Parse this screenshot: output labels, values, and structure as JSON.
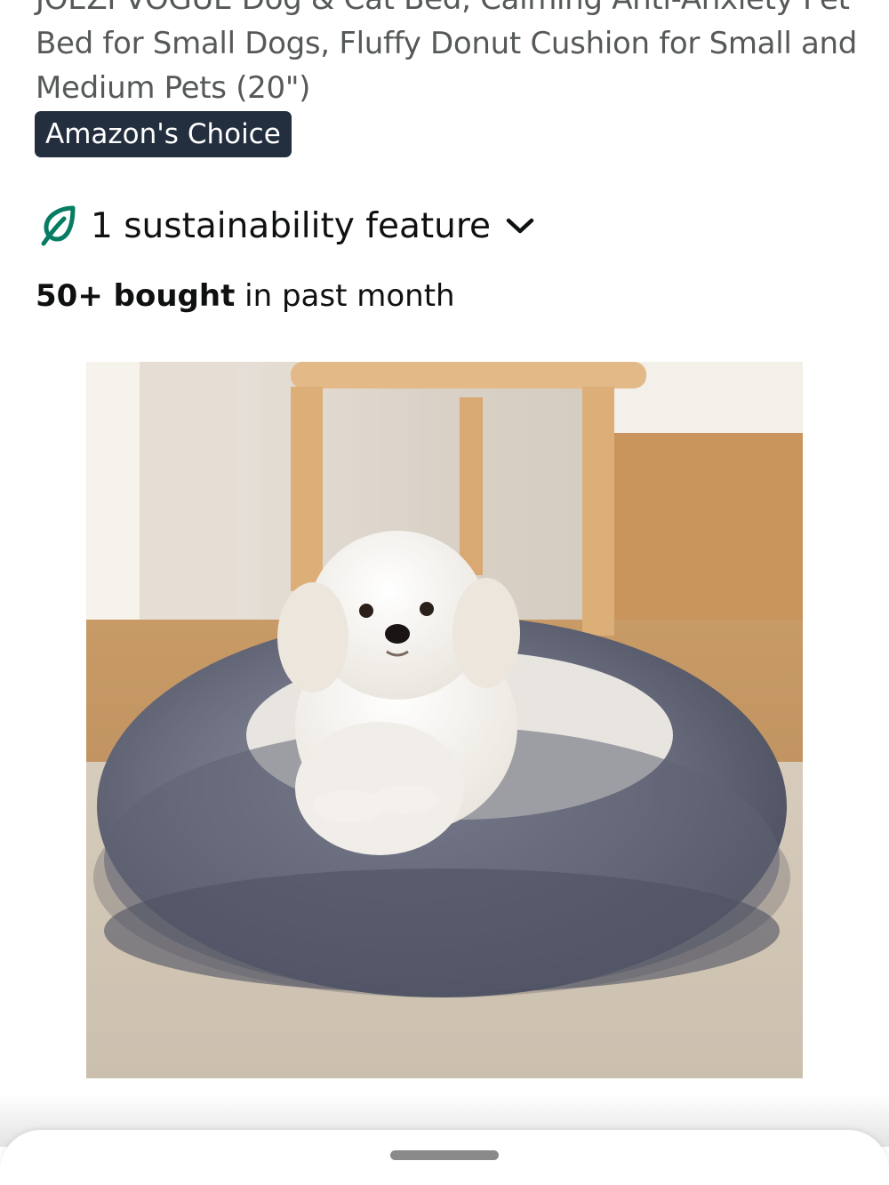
{
  "product": {
    "title_line_1": "JOEZI VOGUE Dog & Cat Bed, Calming Anti-Anxiety Pet",
    "title_line_2": "Bed for Small Dogs, Fluffy Donut Cushion for Small and",
    "title_line_3": "Medium Pets (20\")",
    "badge": "Amazon's Choice",
    "sustainability": {
      "label": "1 sustainability feature",
      "icon": "leaf-icon",
      "expand_icon": "chevron-down-icon"
    },
    "bought": {
      "strong": "50+ bought",
      "rest": " in past month"
    },
    "image_description_icon": "product-image"
  },
  "bottom_sheet": {
    "handle_icon": "drag-handle"
  },
  "colors": {
    "badge_bg": "#232f3e",
    "leaf_green": "#067d62",
    "title_gray": "#565959"
  }
}
